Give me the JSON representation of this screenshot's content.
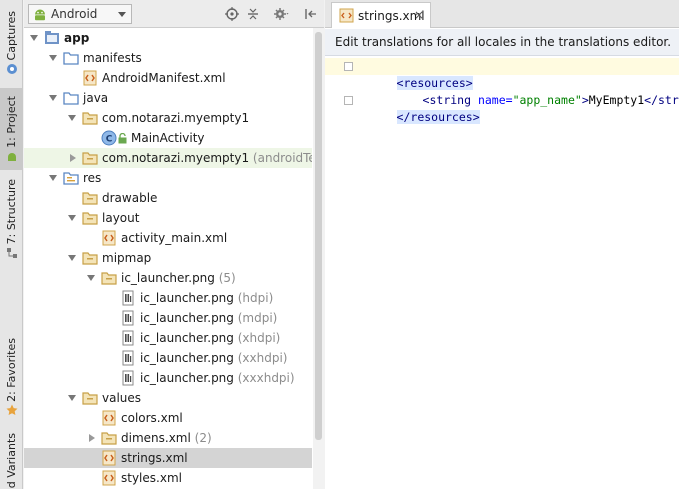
{
  "left_strip": {
    "tabs": [
      {
        "label": "Captures"
      },
      {
        "label": "1: Project"
      },
      {
        "label": "7: Structure"
      },
      {
        "label": "2: Favorites"
      },
      {
        "label": "d Variants"
      }
    ]
  },
  "project_panel": {
    "view_select": {
      "value": "Android"
    },
    "header_icons": [
      "target-icon",
      "collapse-icon",
      "gear-icon",
      "hide-panel-icon"
    ]
  },
  "tree": [
    {
      "label": "app",
      "suffix": "",
      "icon": "module-icon",
      "arrow": "down",
      "bold": true
    },
    {
      "label": "manifests",
      "suffix": "",
      "icon": "folder-icon",
      "arrow": "down"
    },
    {
      "label": "AndroidManifest.xml",
      "suffix": "",
      "icon": "xml-file-icon",
      "arrow": ""
    },
    {
      "label": "java",
      "suffix": "",
      "icon": "folder-icon",
      "arrow": "down"
    },
    {
      "label": "com.notarazi.myempty1",
      "suffix": "",
      "icon": "package-icon",
      "arrow": "down"
    },
    {
      "label": "MainActivity",
      "suffix": "",
      "icon": "class-icon",
      "arrow": ""
    },
    {
      "label": "com.notarazi.myempty1",
      "suffix": " (androidTest)",
      "icon": "package-icon",
      "arrow": "right",
      "highlight": true
    },
    {
      "label": "res",
      "suffix": "",
      "icon": "res-folder-icon",
      "arrow": "down"
    },
    {
      "label": "drawable",
      "suffix": "",
      "icon": "package-icon",
      "arrow": ""
    },
    {
      "label": "layout",
      "suffix": "",
      "icon": "package-icon",
      "arrow": "down"
    },
    {
      "label": "activity_main.xml",
      "suffix": "",
      "icon": "xml-file-icon",
      "arrow": ""
    },
    {
      "label": "mipmap",
      "suffix": "",
      "icon": "package-icon",
      "arrow": "down"
    },
    {
      "label": "ic_launcher.png",
      "suffix": " (5)",
      "icon": "package-icon",
      "arrow": "down"
    },
    {
      "label": "ic_launcher.png",
      "suffix": " (hdpi)",
      "icon": "image-file-icon",
      "arrow": ""
    },
    {
      "label": "ic_launcher.png",
      "suffix": " (mdpi)",
      "icon": "image-file-icon",
      "arrow": ""
    },
    {
      "label": "ic_launcher.png",
      "suffix": " (xhdpi)",
      "icon": "image-file-icon",
      "arrow": ""
    },
    {
      "label": "ic_launcher.png",
      "suffix": " (xxhdpi)",
      "icon": "image-file-icon",
      "arrow": ""
    },
    {
      "label": "ic_launcher.png",
      "suffix": " (xxxhdpi)",
      "icon": "image-file-icon",
      "arrow": ""
    },
    {
      "label": "values",
      "suffix": "",
      "icon": "package-icon",
      "arrow": "down"
    },
    {
      "label": "colors.xml",
      "suffix": "",
      "icon": "xml-file-icon",
      "arrow": ""
    },
    {
      "label": "dimens.xml",
      "suffix": " (2)",
      "icon": "package-icon",
      "arrow": "right"
    },
    {
      "label": "strings.xml",
      "suffix": "",
      "icon": "xml-file-icon",
      "arrow": "",
      "selected": true
    },
    {
      "label": "styles.xml",
      "suffix": "",
      "icon": "xml-file-icon",
      "arrow": ""
    }
  ],
  "editor": {
    "tab": {
      "label": "strings.xml",
      "close": "×"
    },
    "banner": "Edit translations for all locales in the translations editor.",
    "code": {
      "line1": "<resources>",
      "line2_open": "<string ",
      "line2_attr": "name=",
      "line2_val": "\"app_name\"",
      "line2_gt": ">",
      "line2_text": "MyEmpty1",
      "line2_close": "</string>",
      "line3": "</resources>"
    }
  },
  "colors": {
    "accent_green": "#6a9f3a",
    "selection": "#d4d4d4",
    "xml_tag": "#000080",
    "xml_attr": "#0000ff",
    "xml_value": "#008000"
  }
}
